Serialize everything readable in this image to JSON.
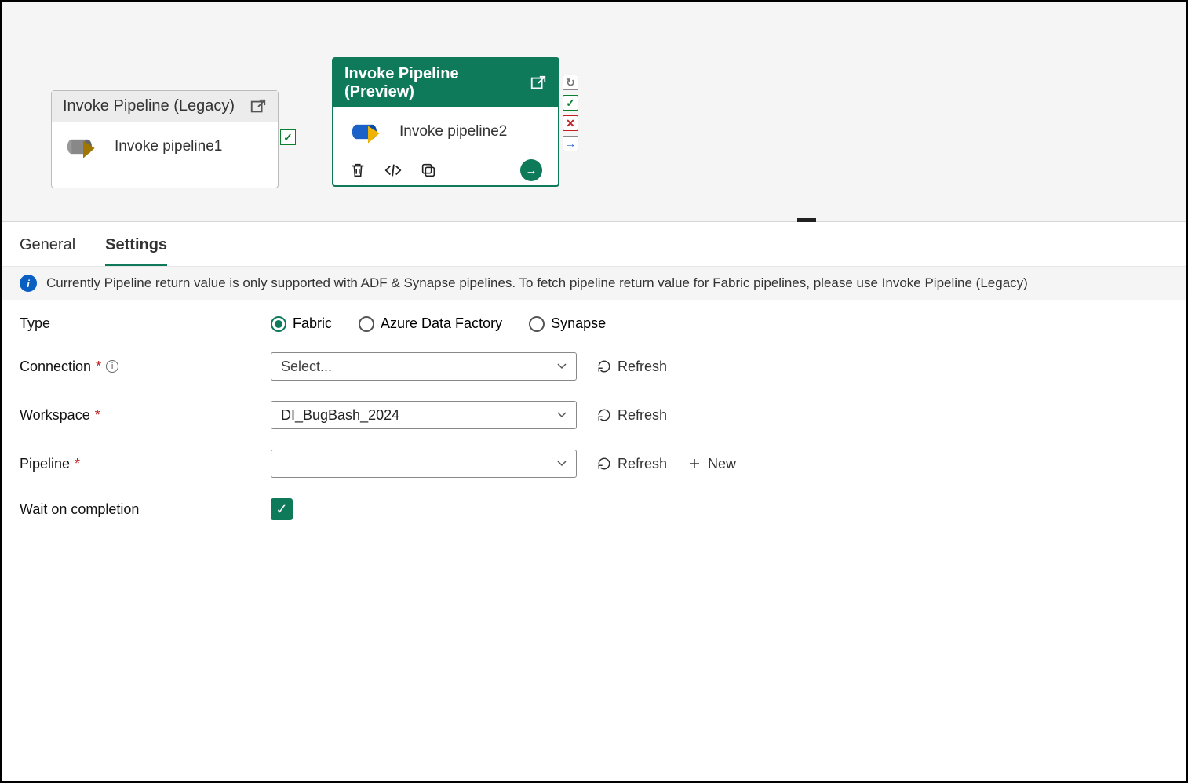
{
  "canvas": {
    "legacy_activity": {
      "title": "Invoke Pipeline (Legacy)",
      "name": "Invoke pipeline1"
    },
    "preview_activity": {
      "title": "Invoke Pipeline (Preview)",
      "name": "Invoke pipeline2"
    }
  },
  "tabs": {
    "general": "General",
    "settings": "Settings"
  },
  "info_bar": "Currently Pipeline return value is only supported with ADF & Synapse pipelines. To fetch pipeline return value for Fabric pipelines, please use Invoke Pipeline (Legacy)",
  "form": {
    "type_label": "Type",
    "type_options": {
      "fabric": "Fabric",
      "adf": "Azure Data Factory",
      "synapse": "Synapse"
    },
    "connection_label": "Connection",
    "connection_placeholder": "Select...",
    "workspace_label": "Workspace",
    "workspace_value": "DI_BugBash_2024",
    "pipeline_label": "Pipeline",
    "wait_label": "Wait on completion",
    "refresh": "Refresh",
    "new": "New"
  }
}
